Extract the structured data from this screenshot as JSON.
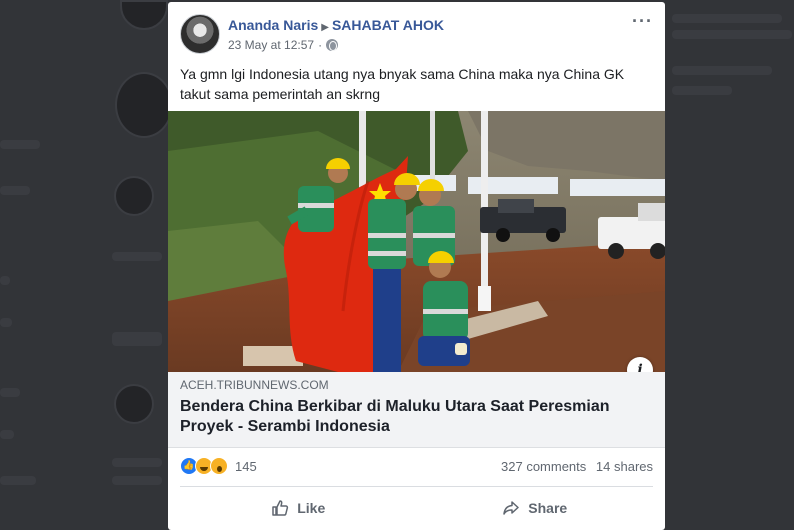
{
  "post": {
    "author": "Ananda Naris",
    "group": "SAHABAT AHOK",
    "timestamp": "23 May at 12:57",
    "privacy_icon": "globe-icon",
    "more_icon": "more-options-icon",
    "text": "Ya gmn lgi Indonesia utang nya bnyak sama China maka nya China GK takut sama pemerintah an skrng",
    "photo_info_label": "i",
    "link": {
      "domain": "ACEH.TRIBUNNEWS.COM",
      "title": "Bendera China Berkibar di Maluku Utara Saat Peresmian Proyek - Serambi Indonesia"
    },
    "stats": {
      "reaction_count": "145",
      "comments": "327 comments",
      "shares": "14 shares"
    },
    "actions": {
      "like": "Like",
      "share": "Share"
    }
  },
  "colors": {
    "link_blue": "#385898",
    "secondary_text": "#606770",
    "like_blue": "#2078f4",
    "reaction_yellow": "#f7b125",
    "flag_red": "#de2910",
    "helmet_yellow": "#f5d000"
  }
}
